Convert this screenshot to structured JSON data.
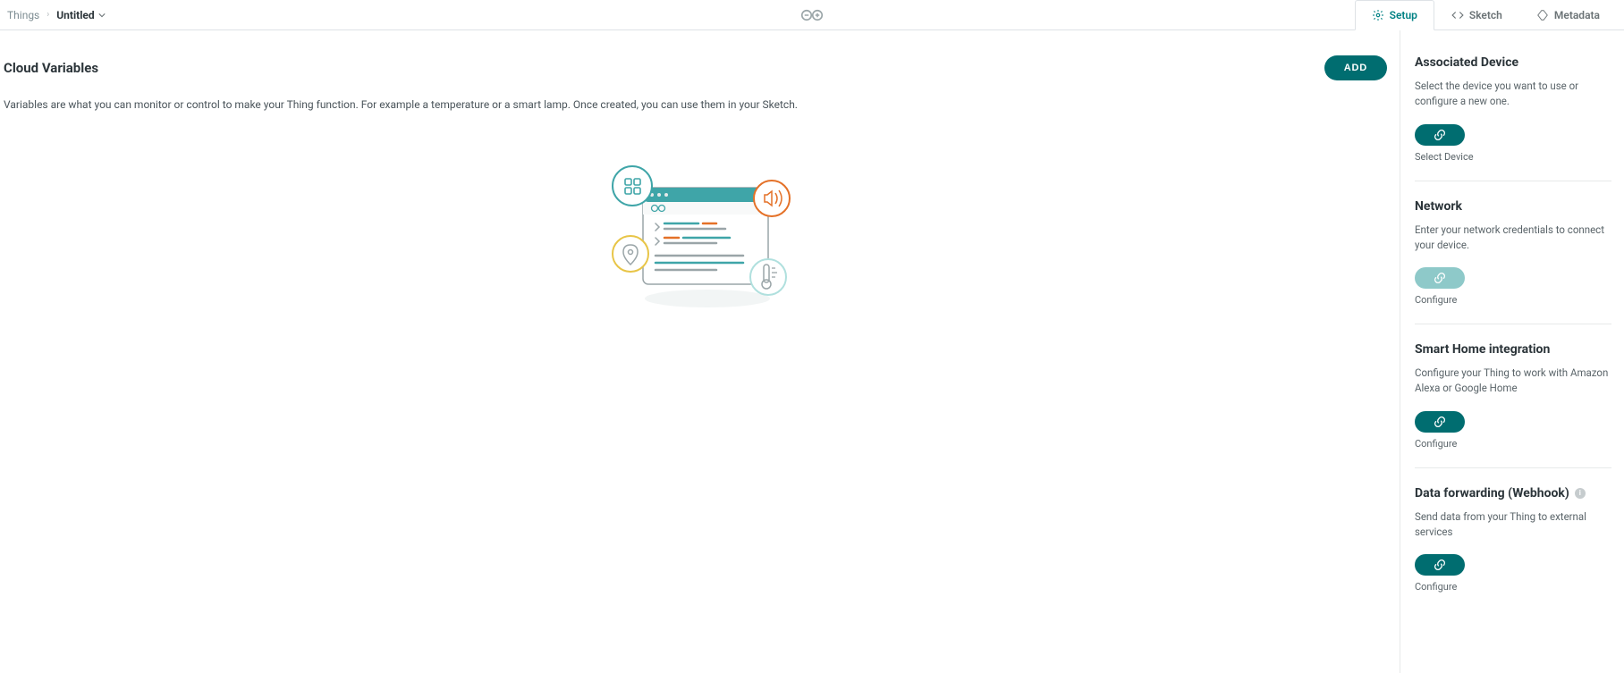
{
  "breadcrumb": {
    "root": "Things",
    "current": "Untitled"
  },
  "tabs": {
    "setup": "Setup",
    "sketch": "Sketch",
    "metadata": "Metadata"
  },
  "main": {
    "title": "Cloud Variables",
    "add_label": "ADD",
    "description": "Variables are what you can monitor or control to make your Thing function. For example a temperature or a smart lamp. Once created, you can use them in your Sketch."
  },
  "panels": {
    "device": {
      "title": "Associated Device",
      "desc": "Select the device you want to use or configure a new one.",
      "btn_label": "Select Device"
    },
    "network": {
      "title": "Network",
      "desc": "Enter your network credentials to connect your device.",
      "btn_label": "Configure"
    },
    "smarthome": {
      "title": "Smart Home integration",
      "desc": "Configure your Thing to work with Amazon Alexa or Google Home",
      "btn_label": "Configure"
    },
    "webhook": {
      "title": "Data forwarding (Webhook)",
      "desc": "Send data from your Thing to external services",
      "btn_label": "Configure"
    }
  }
}
